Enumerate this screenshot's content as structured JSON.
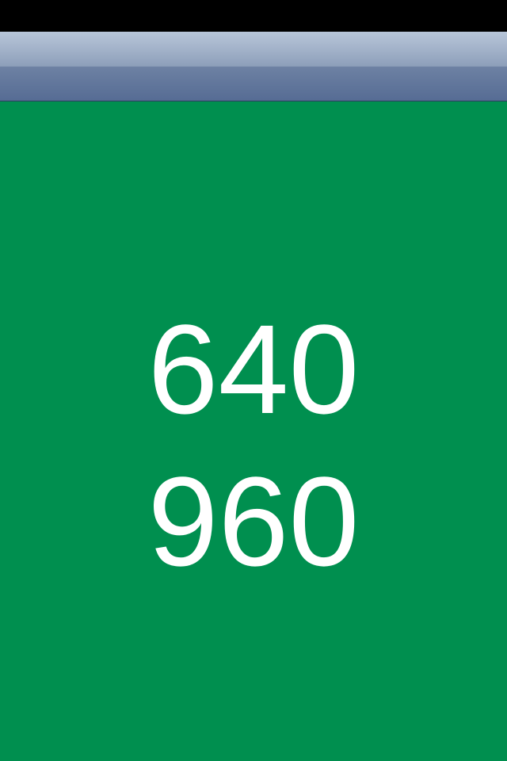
{
  "screen": {
    "width_label": "640",
    "height_label": "960",
    "colors": {
      "status_bar": "#000000",
      "nav_bar_top": "#b8c6d9",
      "nav_bar_bottom": "#566c94",
      "background": "#008f4f",
      "text": "#ffffff"
    }
  }
}
